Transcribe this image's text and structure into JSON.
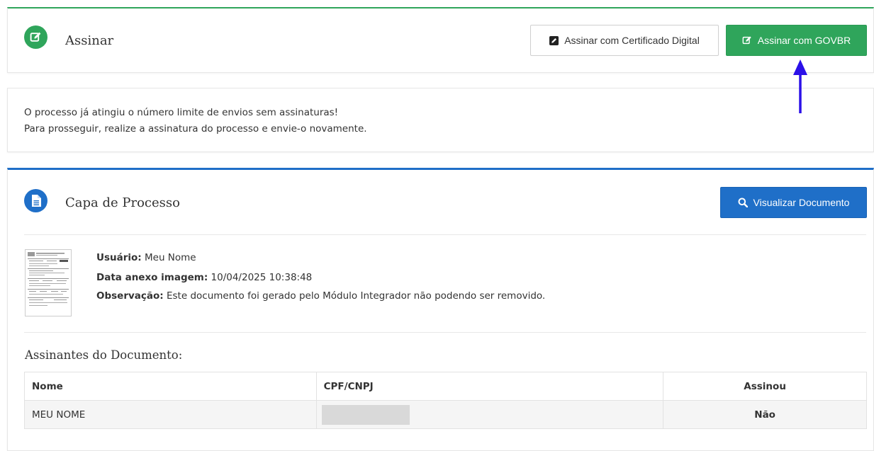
{
  "sign_panel": {
    "title": "Assinar",
    "icon": "edit-icon",
    "buttons": {
      "certificate_label": "Assinar com Certificado Digital",
      "govbr_label": "Assinar com GOVBR"
    }
  },
  "message": {
    "line1": "O processo já atingiu o número limite de envios sem assinaturas!",
    "line2": "Para prosseguir, realize a assinatura do processo e envie-o novamente."
  },
  "document_panel": {
    "title": "Capa de Processo",
    "icon": "document-icon",
    "view_button_label": "Visualizar Documento",
    "meta": {
      "user_label": "Usuário:",
      "user_value": "Meu Nome",
      "date_label": "Data anexo imagem:",
      "date_value": "10/04/2025 10:38:48",
      "obs_label": "Observação:",
      "obs_value": "Este documento foi gerado pelo Módulo Integrador não podendo ser removido."
    },
    "signers": {
      "title": "Assinantes do Documento:",
      "columns": [
        "Nome",
        "CPF/CNPJ",
        "Assinou"
      ],
      "rows": [
        {
          "name": "MEU NOME",
          "cpf": "",
          "signed": "Não"
        }
      ]
    }
  },
  "colors": {
    "green": "#2fa55b",
    "blue": "#1f6fc8",
    "red": "#e2231a",
    "annotation_arrow": "#2b10e8"
  }
}
